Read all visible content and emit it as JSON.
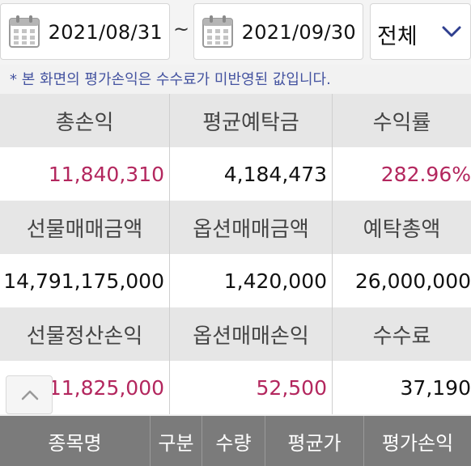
{
  "date_range": {
    "start": "2021/08/31",
    "separator": "~",
    "end": "2021/09/30"
  },
  "filter": {
    "selected": "전체"
  },
  "notice": "* 본 화면의 평가손익은 수수료가 미반영된 값입니다.",
  "summary": {
    "row1_labels": [
      "총손익",
      "평균예탁금",
      "수익률"
    ],
    "row1_values": [
      "11,840,310",
      "4,184,473",
      "282.96%"
    ],
    "row2_labels": [
      "선물매매금액",
      "옵션매매금액",
      "예탁총액"
    ],
    "row2_values": [
      "14,791,175,000",
      "1,420,000",
      "26,000,000"
    ],
    "row3_labels": [
      "선물정산손익",
      "옵션매매손익",
      "수수료"
    ],
    "row3_values": [
      "11,825,000",
      "52,500",
      "37,190"
    ]
  },
  "table_header": [
    "종목명",
    "구분",
    "수량",
    "평균가",
    "평가손익"
  ],
  "colors": {
    "positive": "#b3275e",
    "header_bg": "#7b7b7b",
    "notice": "#4453a0"
  },
  "icons": {
    "date": "calendar-icon",
    "dropdown": "chevron-down-icon",
    "scroll": "chevron-up-icon"
  }
}
